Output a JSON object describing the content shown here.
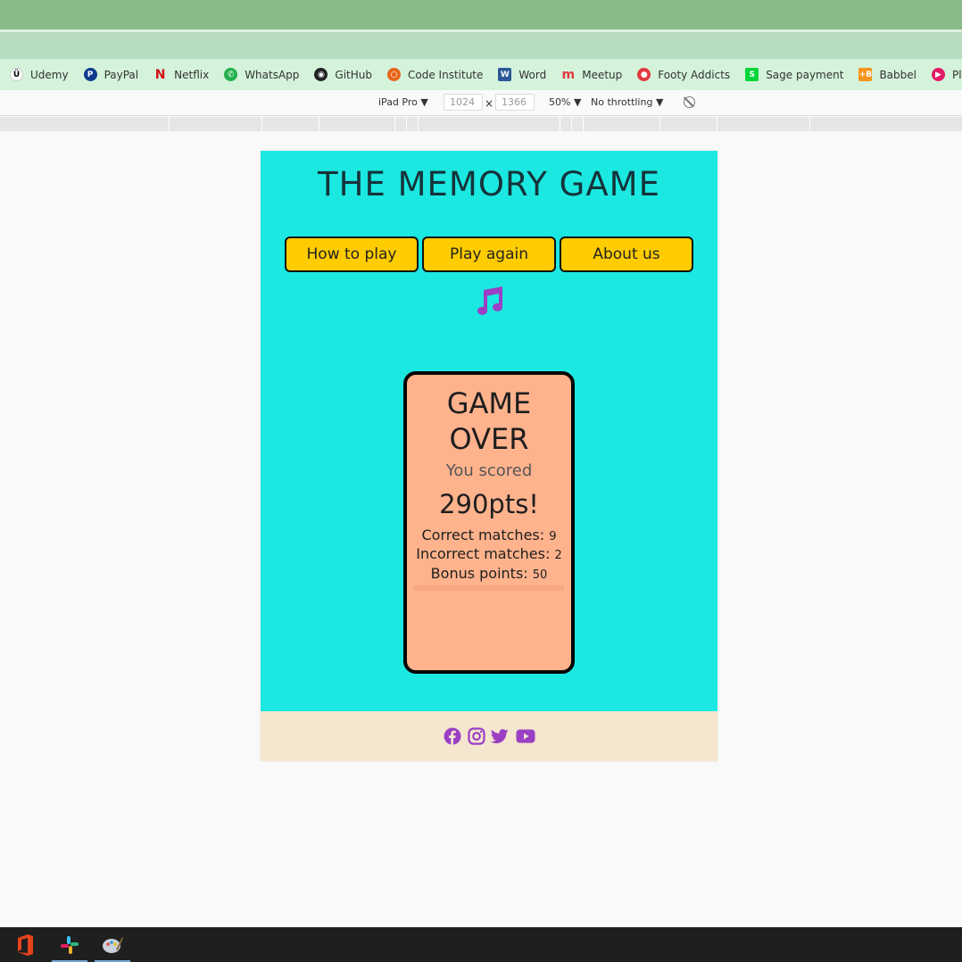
{
  "bookmarks": [
    {
      "label": "Udemy",
      "icon": "udemy-icon",
      "color": "#ffffff",
      "glyph": "Ü"
    },
    {
      "label": "PayPal",
      "icon": "paypal-icon",
      "color": "#0d3c8c",
      "glyph": "P"
    },
    {
      "label": "Netflix",
      "icon": "netflix-icon",
      "color": "#d10f14",
      "glyph": "N"
    },
    {
      "label": "WhatsApp",
      "icon": "whatsapp-icon",
      "color": "#22b14c",
      "glyph": "✆"
    },
    {
      "label": "GitHub",
      "icon": "github-icon",
      "color": "#222222",
      "glyph": "◉"
    },
    {
      "label": "Code Institute",
      "icon": "code-institute-icon",
      "color": "#e8651a",
      "glyph": "○"
    },
    {
      "label": "Word",
      "icon": "word-icon",
      "color": "#2b5797",
      "glyph": "W"
    },
    {
      "label": "Meetup",
      "icon": "meetup-icon",
      "color": "#e0393e",
      "glyph": "m"
    },
    {
      "label": "Footy Addicts",
      "icon": "footy-addicts-icon",
      "color": "#e2383f",
      "glyph": "●"
    },
    {
      "label": "Sage payment",
      "icon": "sage-icon",
      "color": "#00d639",
      "glyph": "S"
    },
    {
      "label": "Babbel",
      "icon": "babbel-icon",
      "color": "#f7941d",
      "glyph": "+B"
    },
    {
      "label": "Pluralsight",
      "icon": "pluralsight-icon",
      "color": "#e21b68",
      "glyph": "▶"
    }
  ],
  "device_toolbar": {
    "device": "iPad Pro ▼",
    "width": "1024",
    "times": "×",
    "height": "1366",
    "zoom": "50% ▼",
    "throttling": "No throttling ▼"
  },
  "game": {
    "title": "THE MEMORY GAME",
    "nav": {
      "how_to_play": "How to play",
      "play_again": "Play again",
      "about_us": "About us"
    },
    "score_card": {
      "heading_line1": "GAME",
      "heading_line2": "OVER",
      "you_scored": "You scored",
      "points": "290pts!",
      "correct_label": "Correct matches:",
      "correct_value": "9",
      "incorrect_label": "Incorrect matches:",
      "incorrect_value": "2",
      "bonus_label": "Bonus points:",
      "bonus_value": "50"
    }
  },
  "footer": {
    "social_icons": [
      "facebook-icon",
      "instagram-icon",
      "twitter-icon",
      "youtube-icon"
    ],
    "icon_color": "#9b3fc4"
  },
  "taskbar": {
    "apps": [
      "office-icon",
      "slack-icon",
      "paint-icon"
    ]
  },
  "colors": {
    "game_bg": "#1be8e0",
    "button_bg": "#ffcc00",
    "card_bg": "#ffb38d",
    "footer_bg": "#f5e6cf",
    "accent_purple": "#9b3fc4"
  }
}
